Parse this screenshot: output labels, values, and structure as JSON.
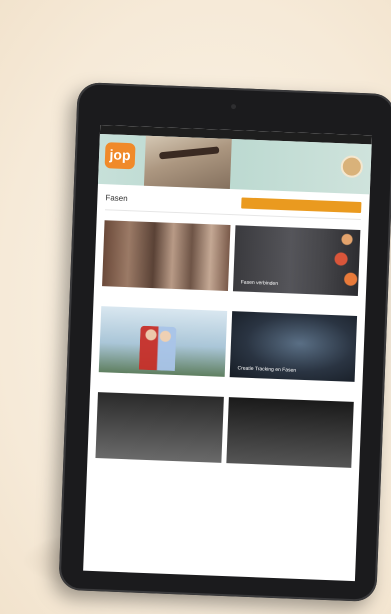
{
  "status_bar": {
    "left": "",
    "right": ""
  },
  "header": {
    "logo_text": "jop",
    "nav_items": [
      "",
      "",
      "",
      ""
    ]
  },
  "page": {
    "title": "Fasen",
    "cta_label": "",
    "subheading": "",
    "intro": ""
  },
  "cards": [
    {
      "label": "",
      "meta_left": "",
      "meta_right": "",
      "date": "",
      "desc": ""
    },
    {
      "label": "Fasen verbinden",
      "meta_left": "",
      "meta_right": "",
      "date": "",
      "desc": ""
    },
    {
      "label": "",
      "meta_left": "",
      "meta_right": "",
      "date": "",
      "desc": ""
    },
    {
      "label": "Creatie Tracking en Fasen",
      "meta_left": "",
      "meta_right": "",
      "date": "",
      "desc": ""
    },
    {
      "label": "",
      "meta_left": "",
      "meta_right": "",
      "date": "",
      "desc": ""
    },
    {
      "label": "",
      "meta_left": "",
      "meta_right": "",
      "date": "",
      "desc": ""
    }
  ],
  "colors": {
    "background": "#f8efe1",
    "accent": "#ea9a1f",
    "logo": "#f08a2a",
    "header": "#c7e0d9"
  },
  "icons": [
    "avatar",
    "camera"
  ]
}
